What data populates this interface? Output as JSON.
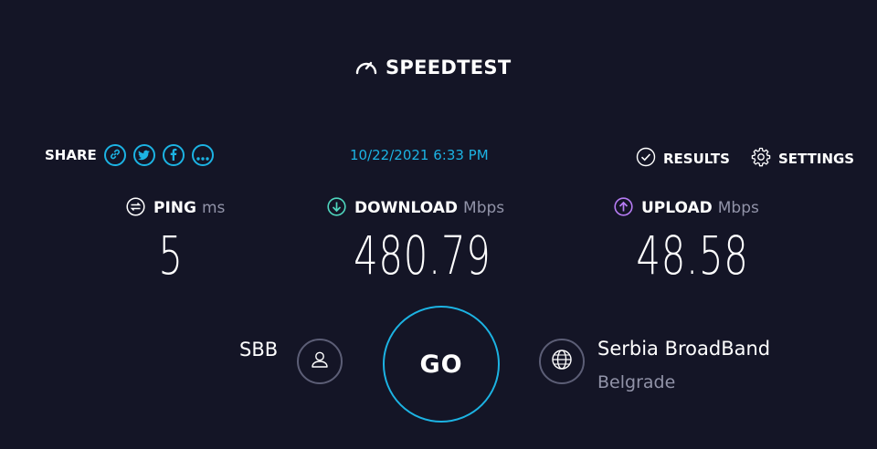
{
  "logo": {
    "text": "SPEEDTEST",
    "icon": "speedometer-icon"
  },
  "share": {
    "label": "SHARE",
    "buttons": [
      "link-icon",
      "twitter-icon",
      "facebook-icon",
      "more-icon"
    ]
  },
  "datetime": "10/22/2021 6:33 PM",
  "nav": {
    "results_label": "RESULTS",
    "settings_label": "SETTINGS"
  },
  "metrics": {
    "ping": {
      "label": "PING",
      "unit": "ms",
      "value": "5"
    },
    "download": {
      "label": "DOWNLOAD",
      "unit": "Mbps",
      "value": "480.79"
    },
    "upload": {
      "label": "UPLOAD",
      "unit": "Mbps",
      "value": "48.58"
    }
  },
  "isp": {
    "name": "SBB",
    "icon": "user-icon"
  },
  "go": {
    "label": "GO"
  },
  "server": {
    "name": "Serbia BroadBand",
    "location": "Belgrade",
    "icon": "globe-icon"
  },
  "colors": {
    "background": "#141526",
    "accent": "#1cb3e3",
    "download": "#4fd6be",
    "upload": "#b77cf5",
    "muted": "#9193a8"
  }
}
